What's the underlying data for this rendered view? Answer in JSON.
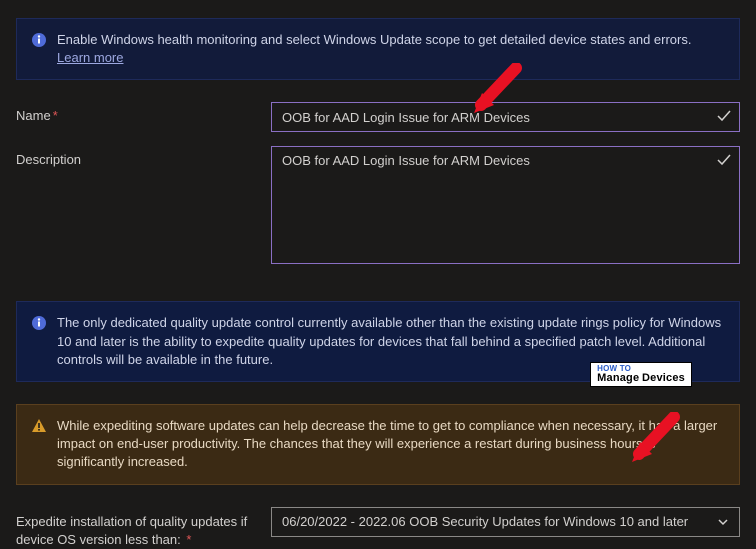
{
  "infoBar1": {
    "text": "Enable Windows health monitoring and select Windows Update scope to get detailed device states and errors.",
    "learnMore": "Learn more"
  },
  "fields": {
    "nameLabel": "Name",
    "nameValue": "OOB for AAD Login Issue for ARM Devices",
    "descriptionLabel": "Description",
    "descriptionValue": "OOB for AAD Login Issue for ARM Devices"
  },
  "infoBar2": {
    "text": "The only dedicated quality update control currently available other than the existing update rings policy for Windows 10 and later is the ability to expedite quality updates for devices that fall behind a specified patch level. Additional controls will be available in the future."
  },
  "warningBar": {
    "text": "While expediting software updates can help decrease the time to get to compliance when necessary, it has a larger impact on end-user productivity. The chances that they will experience a restart during business hours is significantly increased."
  },
  "expedite": {
    "label": "Expedite installation of quality updates if device OS version less than:",
    "selected": "06/20/2022 - 2022.06 OOB Security Updates for Windows 10 and later"
  },
  "watermark": {
    "top": "HOW TO",
    "main": "Manage",
    "sub": "Devices"
  }
}
